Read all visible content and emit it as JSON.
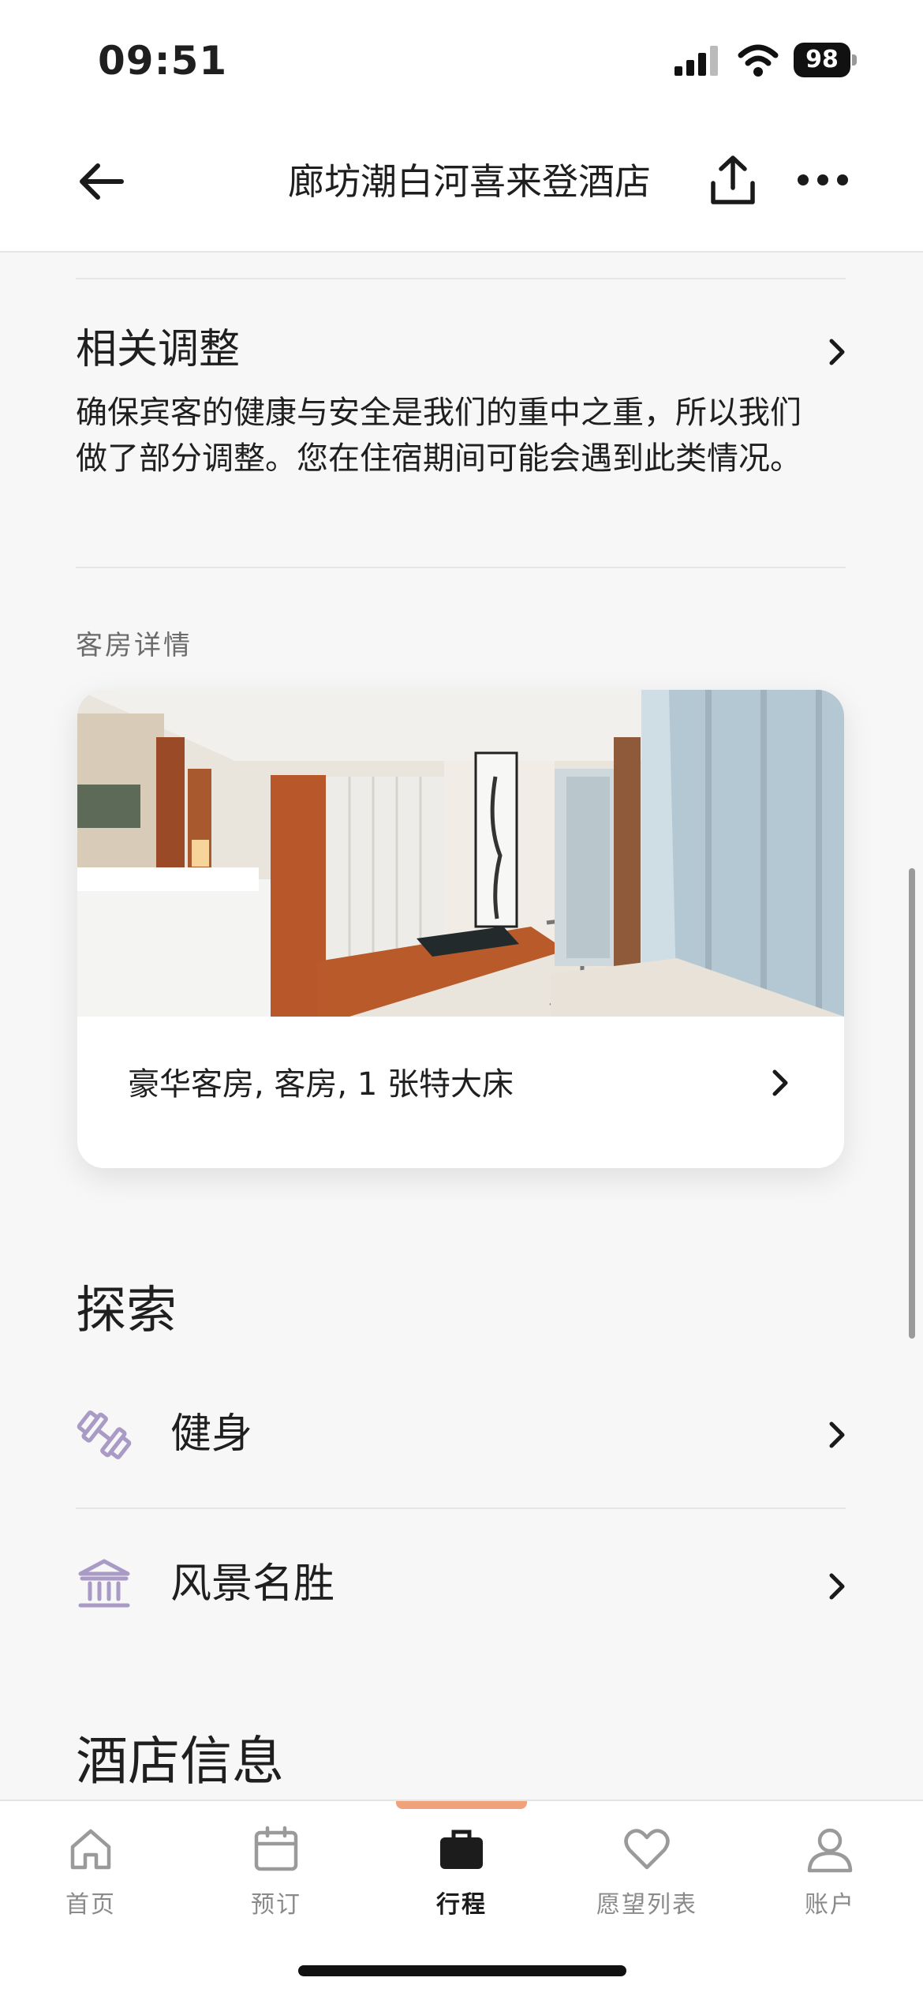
{
  "status_bar": {
    "time": "09:51",
    "battery": "98"
  },
  "header": {
    "title": "廊坊潮白河喜来登酒店"
  },
  "adjustments": {
    "title": "相关调整",
    "body": "确保宾客的健康与安全是我们的重中之重，所以我们做了部分调整。您在住宿期间可能会遇到此类情况。"
  },
  "room_details": {
    "section_label": "客房详情",
    "room_name": "豪华客房, 客房, 1 张特大床"
  },
  "explore": {
    "title": "探索",
    "items": [
      {
        "label": "健身",
        "icon": "dumbbell-icon"
      },
      {
        "label": "风景名胜",
        "icon": "landmark-icon"
      }
    ]
  },
  "hotel_info": {
    "title": "酒店信息"
  },
  "tabbar": {
    "tabs": [
      {
        "label": "首页",
        "icon": "home-icon"
      },
      {
        "label": "预订",
        "icon": "calendar-icon"
      },
      {
        "label": "行程",
        "icon": "briefcase-icon",
        "active": true
      },
      {
        "label": "愿望列表",
        "icon": "heart-icon"
      },
      {
        "label": "账户",
        "icon": "user-icon"
      }
    ],
    "active_color": "#f0a27a"
  },
  "colors": {
    "icon_accent": "#a99bc6",
    "text": "#1f1f1f"
  }
}
